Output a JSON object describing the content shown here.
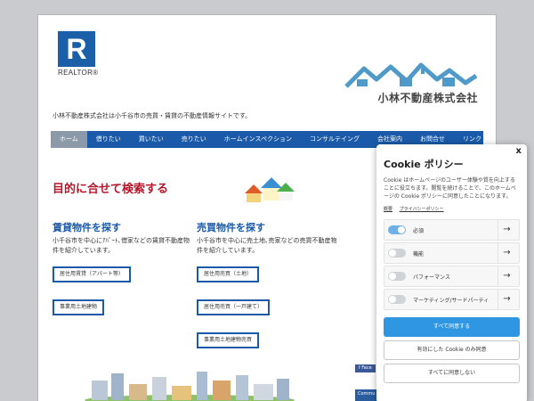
{
  "header": {
    "realtor_letter": "R",
    "realtor_word": "REALTOR®",
    "company_name": "小林不動産株式会社",
    "tagline": "小林不動産株式会社は小千谷市の売買・賃貸の不動産情報サイトです。"
  },
  "nav": {
    "items": [
      "ホーム",
      "借りたい",
      "買いたい",
      "売りたい",
      "ホームインスペクション",
      "コンサルテイング",
      "会社案内",
      "お問合せ",
      "リンク"
    ],
    "active_index": 0
  },
  "main": {
    "headline": "目的に合せて検索する",
    "rental": {
      "title": "賃貸物件を探す",
      "description": "小千谷市を中心にｱﾊﾟｰﾄ､借家などの賃貸不動産物件を紹介しています。",
      "links": [
        "居住用賃貸（アパート等）",
        "事業用土地建物"
      ]
    },
    "sale": {
      "title": "売買物件を探す",
      "description": "小千谷市を中心に売土地､売家などの売買不動産物件を紹介しています。",
      "links": [
        "居住用売買（土地）",
        "居住用売買（一戸建て）",
        "事業用土地建物売買"
      ]
    }
  },
  "sidebar": {
    "social_label": "f Face",
    "community_label": "Commu"
  },
  "cookie": {
    "close": "x",
    "title": "Cookie ポリシー",
    "body": "Cookie はホームページのユーザー体験や質を向上することに役立ちます。閲覧を続けることで、このホームページの Cookie ポリシーに同意したことになります。",
    "links": [
      "概要",
      "プライバシーポリシー"
    ],
    "categories": [
      {
        "label": "必須",
        "on": true
      },
      {
        "label": "機能",
        "on": false
      },
      {
        "label": "パフォーマンス",
        "on": false
      },
      {
        "label": "マーケティング/サードパーティ",
        "on": false
      }
    ],
    "accept_all": "すべて同意する",
    "accept_enabled": "有効にした Cookie のみ同意",
    "reject_all": "すべてに同意しない"
  },
  "colors": {
    "brand_blue": "#1a5aa8",
    "headline_red": "#b8142a",
    "accept_blue": "#2f97e2",
    "toggle_on": "#6fb0e6"
  }
}
